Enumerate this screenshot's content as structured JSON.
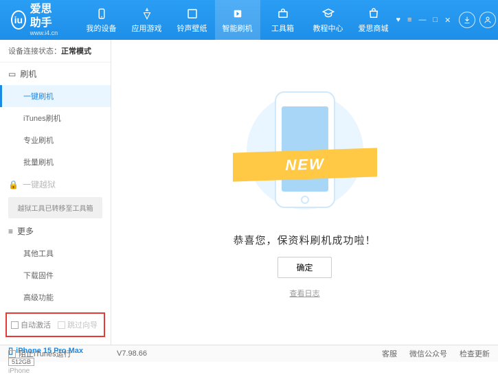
{
  "header": {
    "logo_title": "爱思助手",
    "logo_sub": "www.i4.cn",
    "nav": [
      {
        "label": "我的设备"
      },
      {
        "label": "应用游戏"
      },
      {
        "label": "铃声壁纸"
      },
      {
        "label": "智能刷机"
      },
      {
        "label": "工具箱"
      },
      {
        "label": "教程中心"
      },
      {
        "label": "爱思商城"
      }
    ]
  },
  "sidebar": {
    "status_label": "设备连接状态：",
    "status_value": "正常模式",
    "section_flash": "刷机",
    "items_flash": [
      "一键刷机",
      "iTunes刷机",
      "专业刷机",
      "批量刷机"
    ],
    "section_jailbreak": "一键越狱",
    "jailbreak_note": "越狱工具已转移至工具箱",
    "section_more": "更多",
    "items_more": [
      "其他工具",
      "下载固件",
      "高级功能"
    ],
    "checkbox1": "自动激活",
    "checkbox2": "跳过向导",
    "device_name": "iPhone 15 Pro Max",
    "device_storage": "512GB",
    "device_type": "iPhone"
  },
  "main": {
    "ribbon": "NEW",
    "success": "恭喜您，保资料刷机成功啦！",
    "ok": "确定",
    "viewlog": "查看日志"
  },
  "footer": {
    "block_itunes": "阻止iTunes运行",
    "version": "V7.98.66",
    "links": [
      "客服",
      "微信公众号",
      "检查更新"
    ]
  }
}
